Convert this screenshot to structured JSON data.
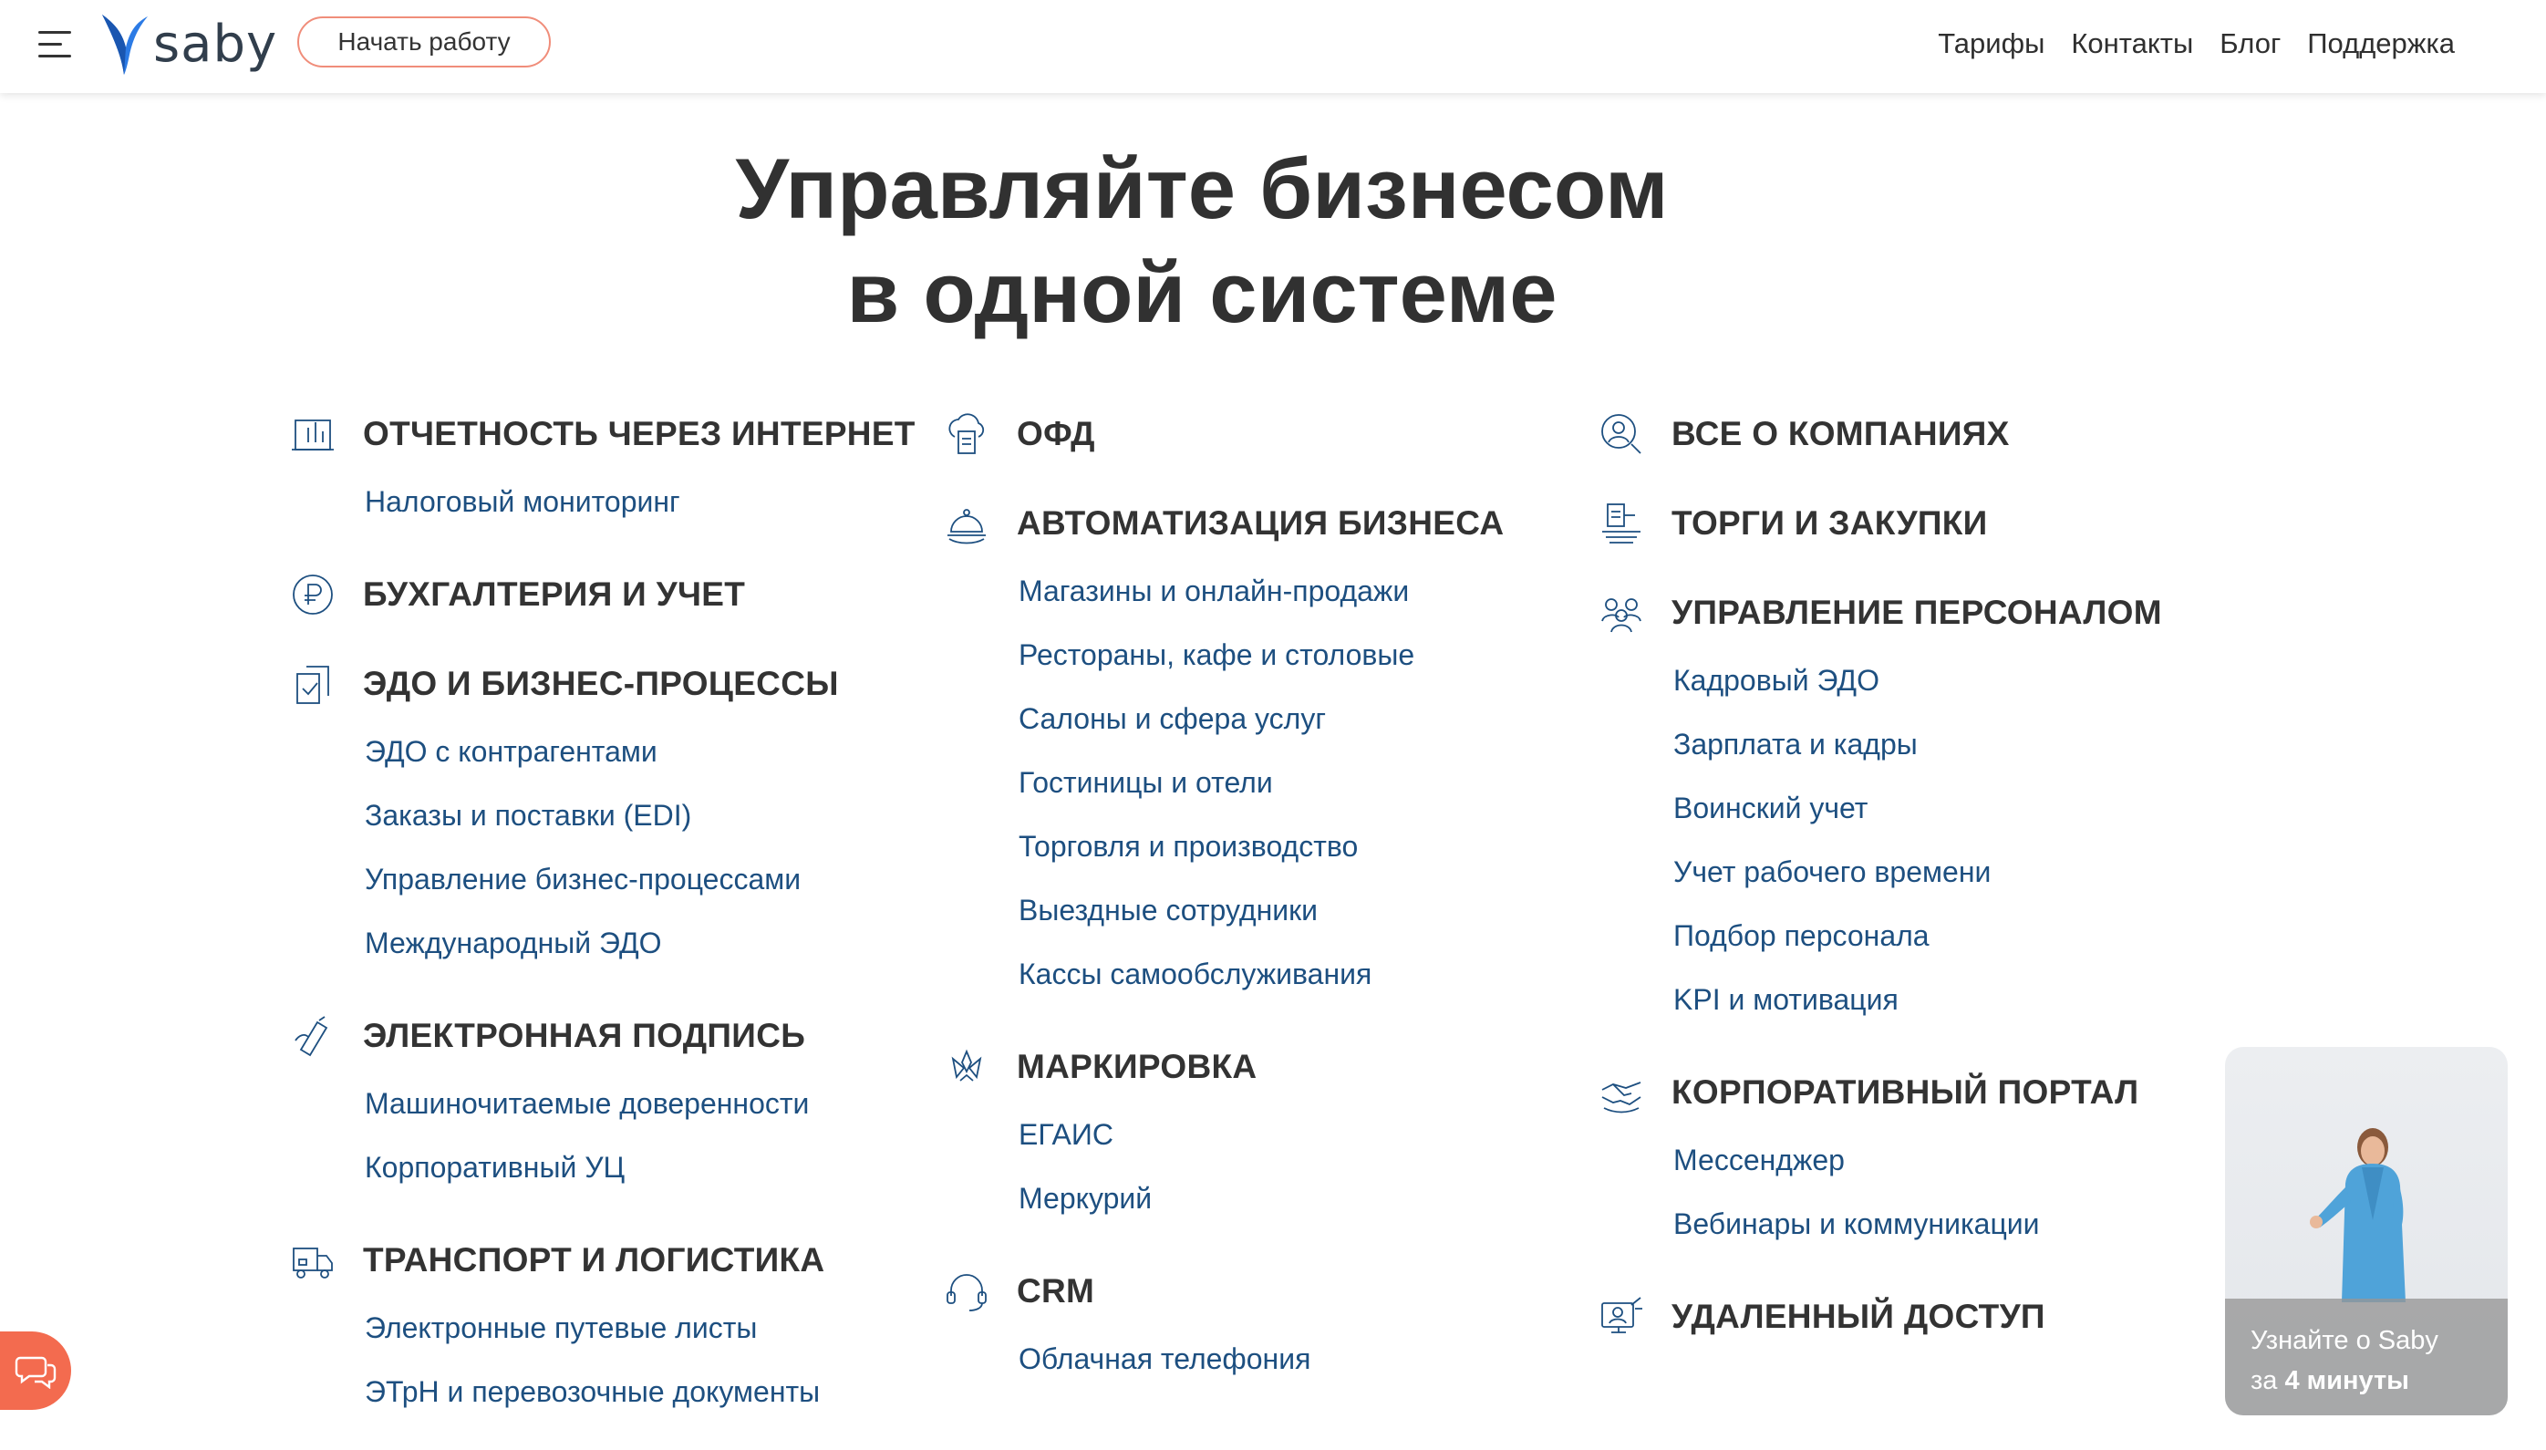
{
  "header": {
    "logo_text": "saby",
    "start_button": "Начать работу",
    "nav": [
      "Тарифы",
      "Контакты",
      "Блог",
      "Поддержка"
    ]
  },
  "hero": {
    "line1": "Управляйте бизнесом",
    "line2": "в одной системе"
  },
  "columns": [
    {
      "sections": [
        {
          "icon": "report-icon",
          "title": "ОТЧЕТНОСТЬ ЧЕРЕЗ ИНТЕРНЕТ",
          "links": [
            "Налоговый мониторинг"
          ]
        },
        {
          "icon": "ruble-icon",
          "title": "БУХГАЛТЕРИЯ И УЧЕТ",
          "links": []
        },
        {
          "icon": "document-flow-icon",
          "title": "ЭДО И БИЗНЕС-ПРОЦЕССЫ",
          "links": [
            "ЭДО с контрагентами",
            "Заказы и поставки (EDI)",
            "Управление бизнес-процессами",
            "Международный ЭДО"
          ]
        },
        {
          "icon": "signature-icon",
          "title": "ЭЛЕКТРОННАЯ ПОДПИСЬ",
          "links": [
            "Машиночитаемые доверенности",
            "Корпоративный УЦ"
          ]
        },
        {
          "icon": "truck-icon",
          "title": "ТРАНСПОРТ И ЛОГИСТИКА",
          "links": [
            "Электронные путевые листы",
            "ЭТрН и перевозочные документы"
          ]
        }
      ]
    },
    {
      "sections": [
        {
          "icon": "cloud-receipt-icon",
          "title": "ОФД",
          "links": []
        },
        {
          "icon": "cloche-icon",
          "title": "АВТОМАТИЗАЦИЯ БИЗНЕСА",
          "links": [
            "Магазины и онлайн-продажи",
            "Рестораны, кафе и столовые",
            "Салоны и сфера услуг",
            "Гостиницы и отели",
            "Торговля и производство",
            "Выездные сотрудники",
            "Кассы самообслуживания"
          ]
        },
        {
          "icon": "marking-icon",
          "title": "МАРКИРОВКА",
          "links": [
            "ЕГАИС",
            "Меркурий"
          ]
        },
        {
          "icon": "headset-icon",
          "title": "CRM",
          "links": [
            "Облачная телефония"
          ]
        }
      ]
    },
    {
      "sections": [
        {
          "icon": "company-search-icon",
          "title": "ВСЕ О КОМПАНИЯХ",
          "links": []
        },
        {
          "icon": "tender-icon",
          "title": "ТОРГИ И ЗАКУПКИ",
          "links": []
        },
        {
          "icon": "staff-icon",
          "title": "УПРАВЛЕНИЕ ПЕРСОНАЛОМ",
          "links": [
            "Кадровый ЭДО",
            "Зарплата и кадры",
            "Воинский учет",
            "Учет рабочего времени",
            "Подбор персонала",
            "KPI и мотивация"
          ]
        },
        {
          "icon": "handshake-icon",
          "title": "КОРПОРАТИВНЫЙ ПОРТАЛ",
          "links": [
            "Мессенджер",
            "Вебинары и коммуникации"
          ]
        },
        {
          "icon": "remote-access-icon",
          "title": "УДАЛЕННЫЙ ДОСТУП",
          "links": []
        }
      ]
    }
  ],
  "promo": {
    "caption_line1": "Узнайте о Saby",
    "caption_prefix": "за ",
    "caption_bold": "4 минуты"
  },
  "colors": {
    "accent": "#f36b4f",
    "link": "#1d4f80",
    "logo_blue": "#2c7be5"
  }
}
